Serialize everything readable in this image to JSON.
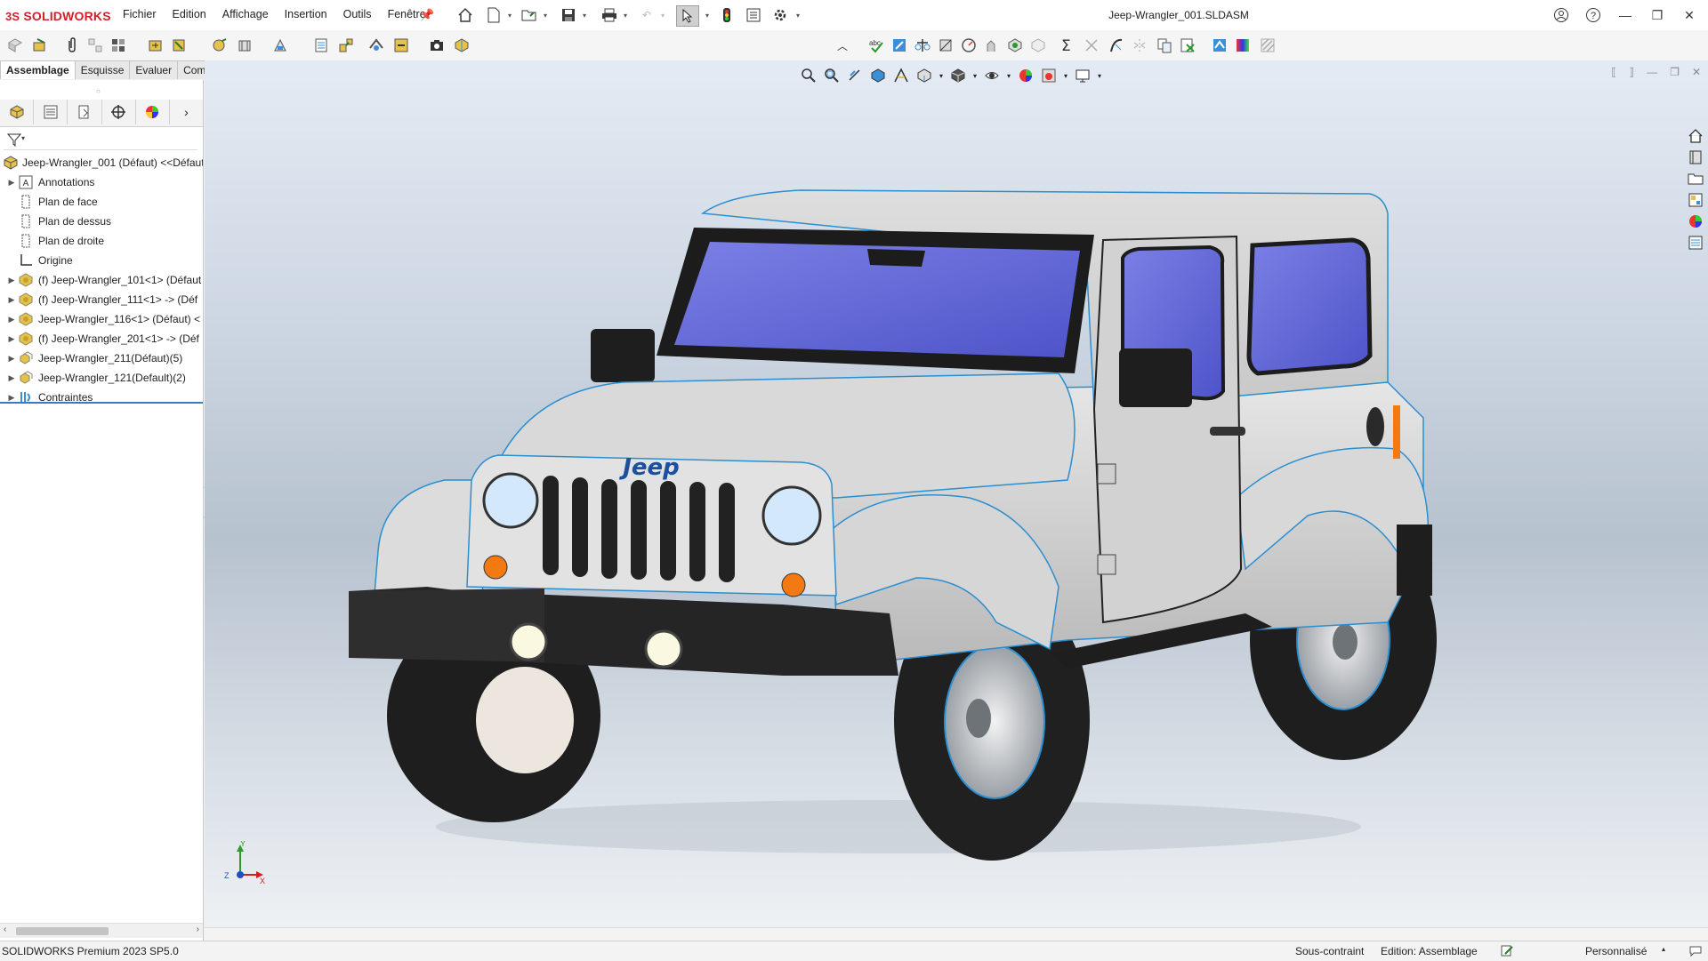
{
  "app": {
    "brand": "SOLIDWORKS",
    "document_title": "Jeep-Wrangler_001.SLDASM"
  },
  "menu": [
    "Fichier",
    "Edition",
    "Affichage",
    "Insertion",
    "Outils",
    "Fenêtre"
  ],
  "command_tabs": [
    {
      "label": "Assemblage",
      "active": true
    },
    {
      "label": "Esquisse",
      "active": false
    },
    {
      "label": "Evaluer",
      "active": false
    },
    {
      "label": "Compléments de SOLIDWORKS",
      "active": false
    }
  ],
  "feature_tree": {
    "root": "Jeep-Wrangler_001 (Défaut) <<Défaut",
    "items": [
      {
        "label": "Annotations",
        "icon": "annotations-icon",
        "expandable": true
      },
      {
        "label": "Plan de face",
        "icon": "plane-icon",
        "expandable": false
      },
      {
        "label": "Plan de dessus",
        "icon": "plane-icon",
        "expandable": false
      },
      {
        "label": "Plan de droite",
        "icon": "plane-icon",
        "expandable": false
      },
      {
        "label": "Origine",
        "icon": "origin-icon",
        "expandable": false
      },
      {
        "label": "(f) Jeep-Wrangler_101<1> (Défaut",
        "icon": "part-icon",
        "expandable": true
      },
      {
        "label": "(f) Jeep-Wrangler_111<1> -> (Déf",
        "icon": "part-icon",
        "expandable": true
      },
      {
        "label": "Jeep-Wrangler_116<1> (Défaut) <",
        "icon": "part-icon",
        "expandable": true
      },
      {
        "label": "(f) Jeep-Wrangler_201<1> -> (Déf",
        "icon": "part-icon",
        "expandable": true
      },
      {
        "label": "Jeep-Wrangler_211(Défaut)(5)",
        "icon": "pattern-icon",
        "expandable": true
      },
      {
        "label": "Jeep-Wrangler_121(Default)(2)",
        "icon": "pattern-icon",
        "expandable": true
      },
      {
        "label": "Contraintes",
        "icon": "mates-icon",
        "expandable": true
      }
    ]
  },
  "viewport": {
    "model_logo": "Jeep",
    "triad": {
      "x": "X",
      "y": "Y",
      "z": "Z"
    }
  },
  "status_bar": {
    "product": "SOLIDWORKS Premium 2023 SP5.0",
    "constraint_state": "Sous-contraint",
    "edit_mode": "Edition: Assemblage",
    "units": "Personnalisé"
  },
  "colors": {
    "brand_red": "#d0202a",
    "selection_blue": "#3c78c8",
    "body_grey": "#cfcfcf",
    "glass": "#6a6fd8",
    "edge_blue": "#2a8fd0"
  }
}
